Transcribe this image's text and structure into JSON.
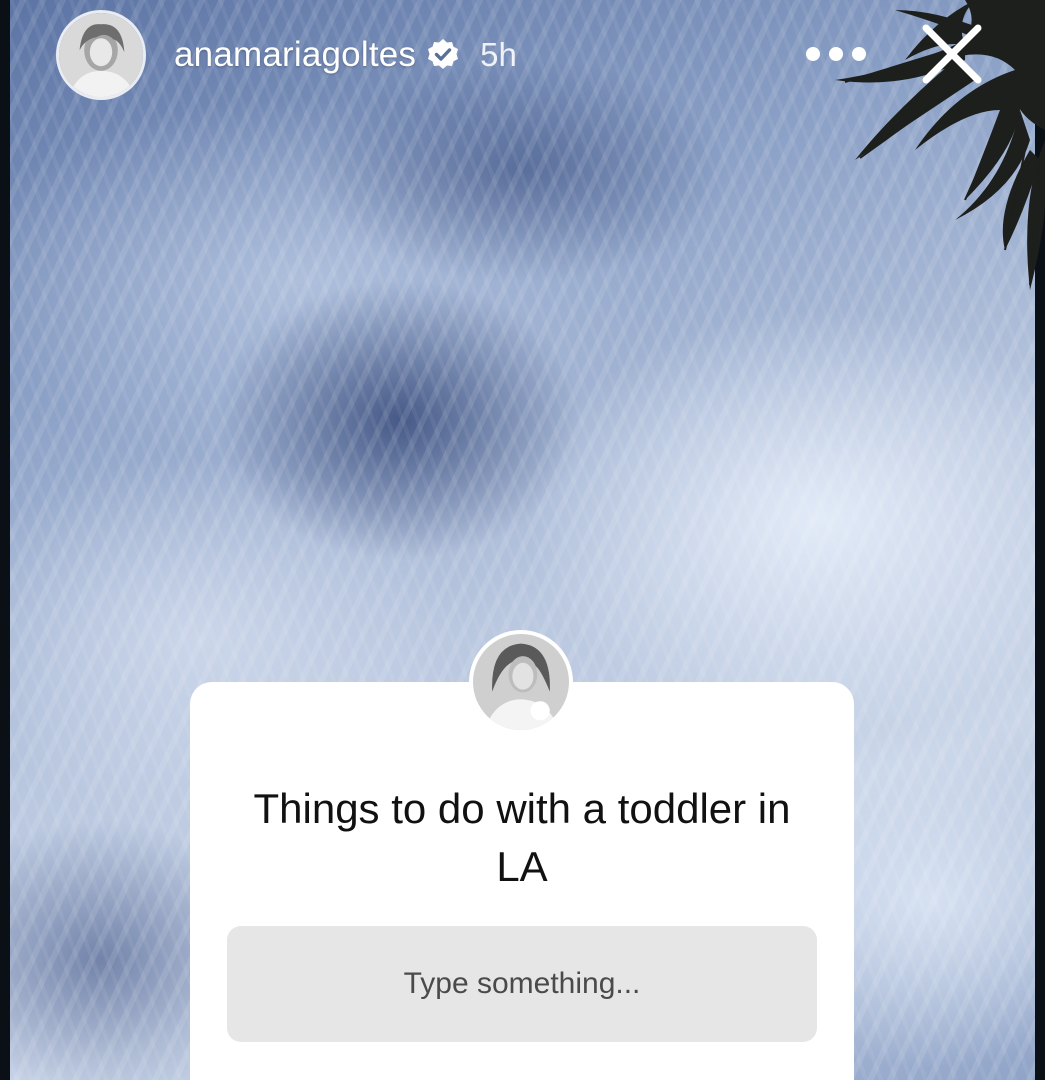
{
  "story": {
    "username": "anamariagoltes",
    "time_ago": "5h"
  },
  "question_sticker": {
    "text": "Things to do with a toddler in LA",
    "placeholder": "Type something..."
  },
  "icons": {
    "verified": "verified-badge-icon",
    "more": "more-options-icon",
    "close": "close-icon"
  },
  "colors": {
    "sky_dark": "#5c74a4",
    "sky_light": "#c9d5e8",
    "card_bg": "#ffffff",
    "input_bg": "#e6e6e6"
  }
}
